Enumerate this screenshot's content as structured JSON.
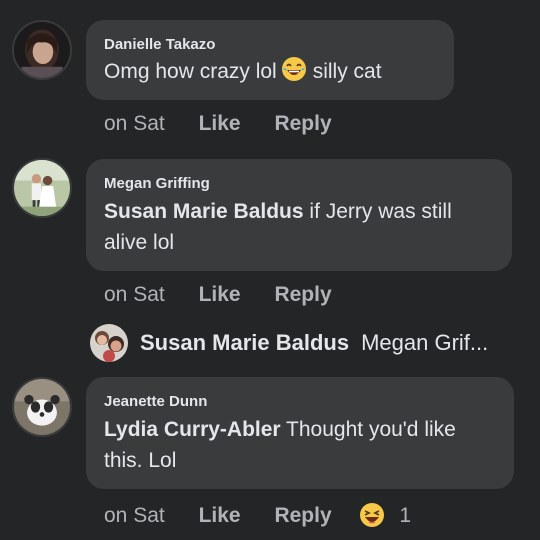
{
  "comments": [
    {
      "author": "Danielle Takazo",
      "text_before": "Omg how crazy lol",
      "emoji_icon": "laughing-face-icon",
      "text_after": "silly cat",
      "time": "on Sat",
      "like": "Like",
      "reply": "Reply"
    },
    {
      "author": "Megan Griffing",
      "mention": "Susan Marie Baldus",
      "text_line1": " if Jerry was still",
      "text_line2": "alive lol",
      "time": "on Sat",
      "like": "Like",
      "reply": "Reply"
    },
    {
      "author": "Jeanette Dunn",
      "mention": "Lydia Curry-Abler",
      "text_line1": " Thought you'd like",
      "text_line2": "this. Lol",
      "time": "on Sat",
      "like": "Like",
      "reply": "Reply",
      "reaction_icon": "haha-reaction-icon",
      "reaction_count": "1"
    }
  ],
  "reply_preview": {
    "author": "Susan Marie Baldus",
    "text": "Megan Grif..."
  },
  "colors": {
    "background": "#242526",
    "bubble": "#3a3b3c",
    "text": "#e4e6eb",
    "meta": "#b0b3b8"
  }
}
